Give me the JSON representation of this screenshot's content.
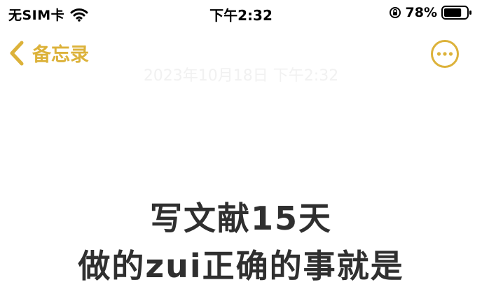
{
  "status_bar": {
    "carrier": "无SIM卡",
    "time": "下午2:32",
    "battery_percent": "78%",
    "battery_level": 0.78,
    "icons": [
      "wifi-icon",
      "orientation-lock-icon",
      "battery-icon"
    ]
  },
  "nav": {
    "back_label": "备忘录",
    "accent_color": "#dcb23a",
    "icons": [
      "chevron-left-icon",
      "more-icon"
    ]
  },
  "note": {
    "date": "2023年10月18日 下午2:32",
    "lines": [
      "写文献15天",
      "做的zui正确的事就是"
    ]
  }
}
